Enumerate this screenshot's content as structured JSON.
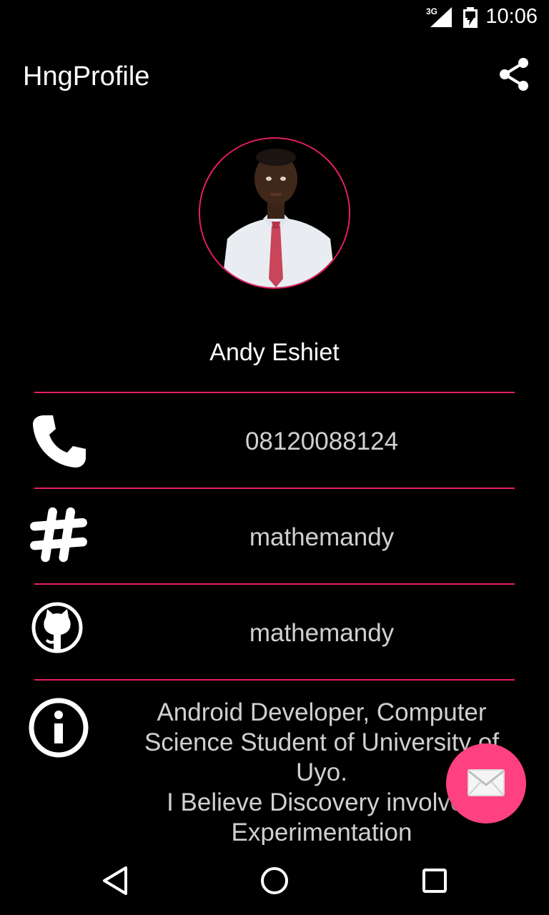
{
  "status_bar": {
    "network": "3G",
    "time": "10:06"
  },
  "app_bar": {
    "title": "HngProfile",
    "share_icon": "share-icon"
  },
  "profile": {
    "name": "Andy Eshiet",
    "phone": "08120088124",
    "slack": "mathemandy",
    "github": "mathemandy",
    "bio": "Android Developer, Computer\nScience Student of University of\nUyo.\nI Believe Discovery involves\nExperimentation"
  },
  "icons": {
    "phone": "phone-icon",
    "slack": "hash-icon",
    "github": "github-icon",
    "info": "info-icon",
    "fab": "mail-icon"
  },
  "nav": {
    "back": "back-icon",
    "home": "home-icon",
    "recents": "recents-icon"
  },
  "colors": {
    "accent": "#e91e63",
    "fab": "#ff4081",
    "background": "#000000",
    "text": "#d0d0d0"
  }
}
